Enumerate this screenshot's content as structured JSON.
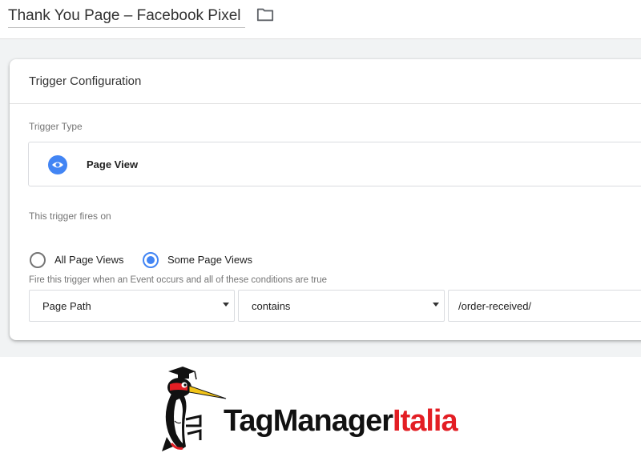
{
  "header": {
    "title": "Thank You Page – Facebook Pixel"
  },
  "card": {
    "title": "Trigger Configuration",
    "trigger_type_label": "Trigger Type",
    "trigger_type_name": "Page View",
    "fires_on_label": "This trigger fires on",
    "options": [
      {
        "label": "All Page Views",
        "selected": false
      },
      {
        "label": "Some Page Views",
        "selected": true
      }
    ],
    "condition_label": "Fire this trigger when an Event occurs and all of these conditions are true",
    "condition": {
      "variable": "Page Path",
      "operator": "contains",
      "value": "/order-received/"
    }
  },
  "logo": {
    "part1": "TagManager",
    "part2": "Italia"
  },
  "colors": {
    "accent": "#4285f4",
    "logo_red": "#e31e24",
    "workspace_bg": "#f1f3f4"
  },
  "icons": [
    "folder-icon",
    "eye-icon",
    "dropdown-caret-icon"
  ]
}
